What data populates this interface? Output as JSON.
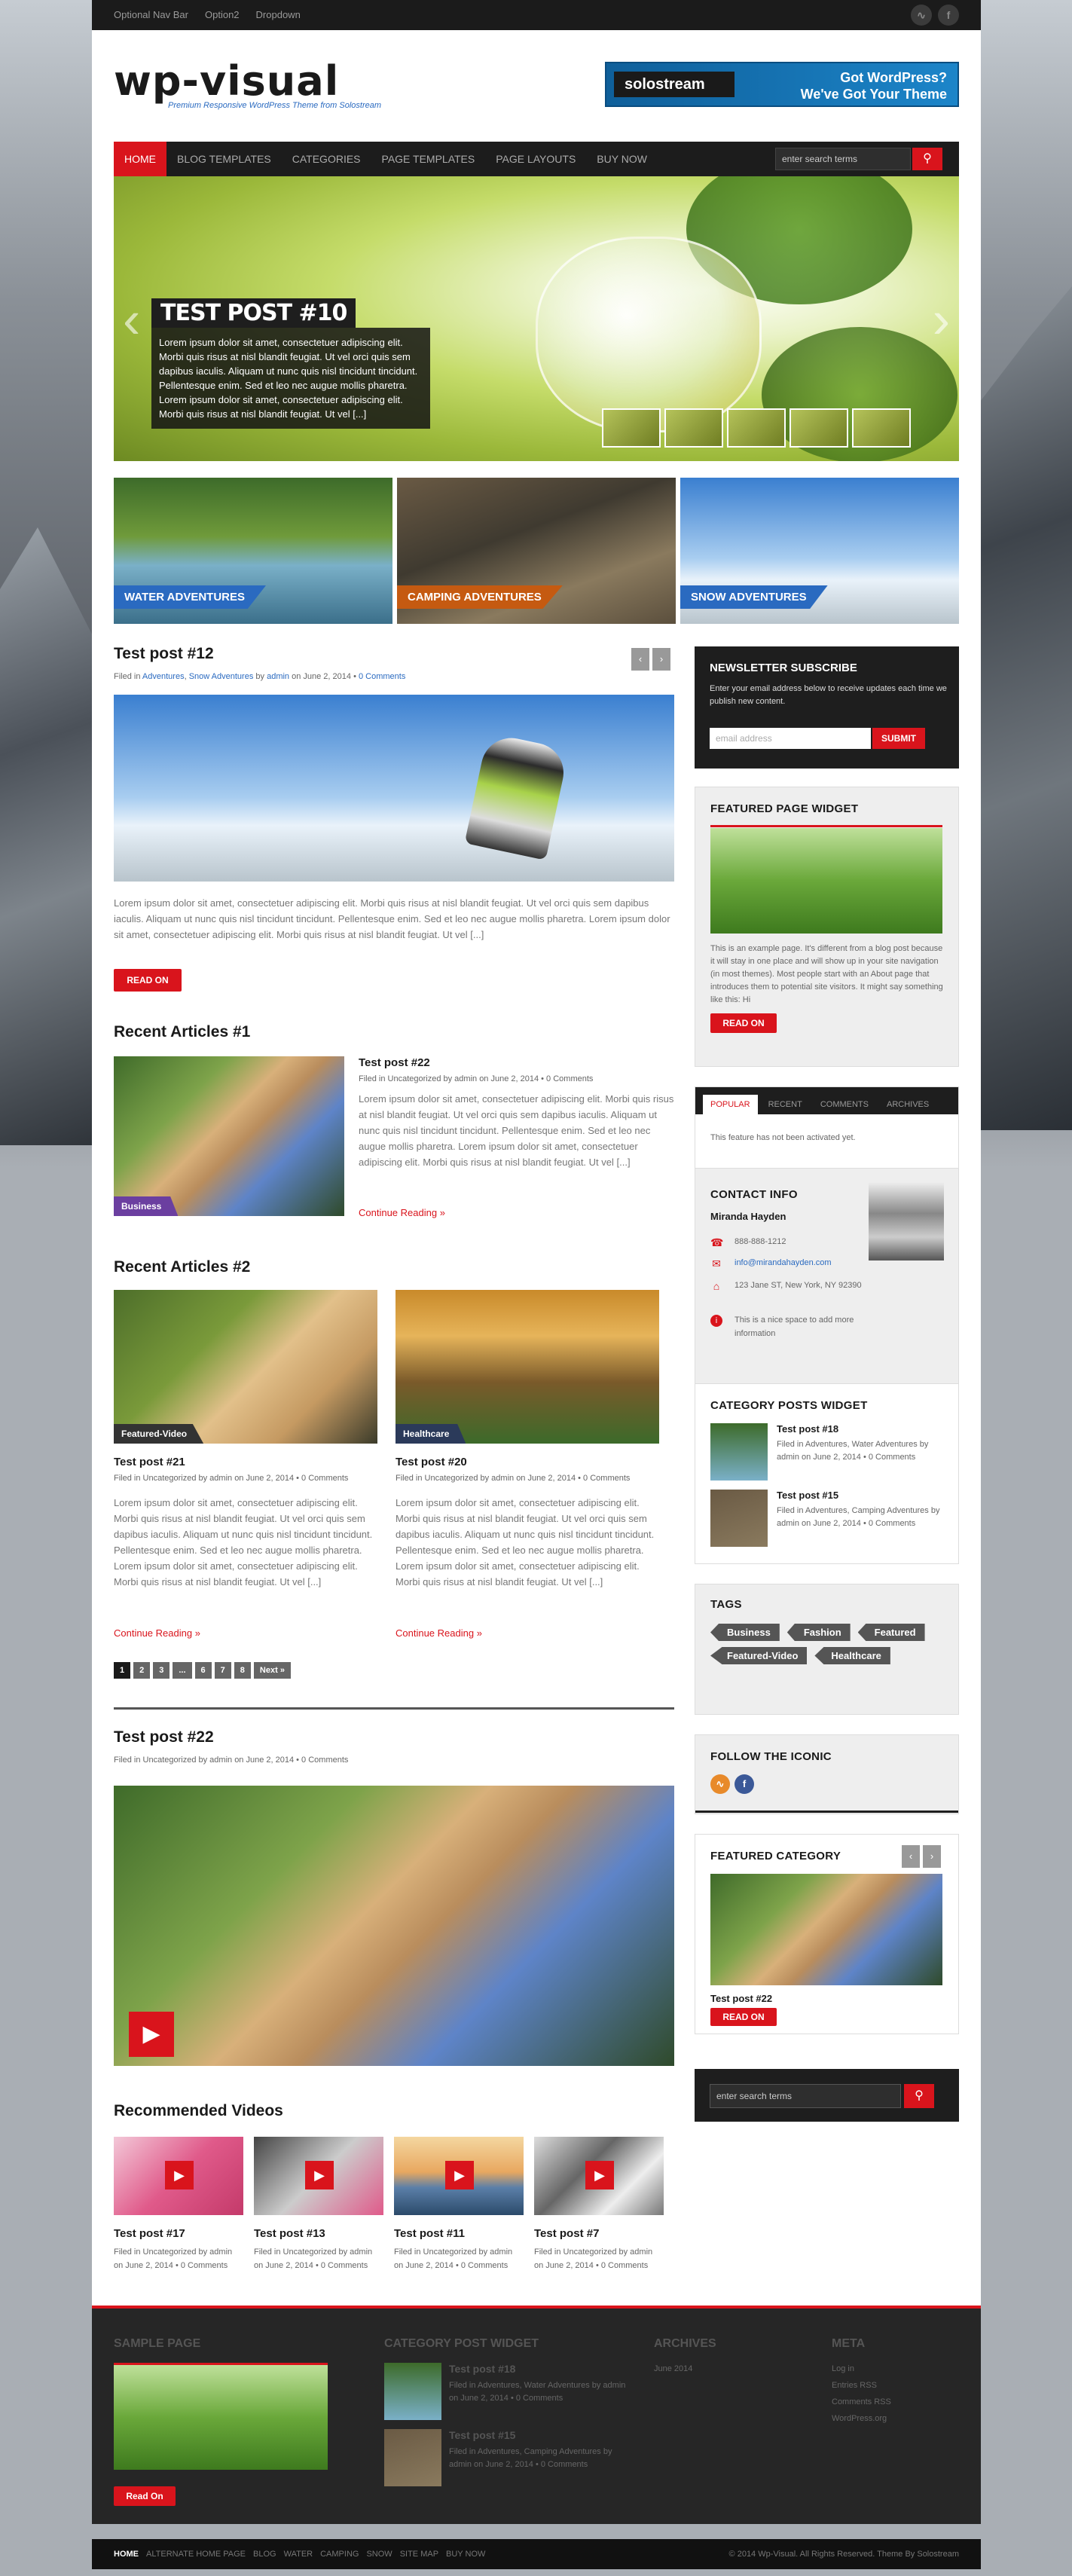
{
  "topbar": {
    "nav": [
      "Optional Nav Bar",
      "Option2",
      "Dropdown"
    ],
    "icons": [
      "rss-icon",
      "facebook-icon"
    ]
  },
  "header": {
    "logo": "wp-visual",
    "tagline": "Premium Responsive WordPress Theme from Solostream",
    "banner": {
      "brand": "solostream",
      "line1": "Got WordPress?",
      "line2": "We've Got Your Theme"
    }
  },
  "nav": {
    "items": [
      "HOME",
      "BLOG TEMPLATES",
      "CATEGORIES",
      "PAGE TEMPLATES",
      "PAGE LAYOUTS",
      "BUY NOW"
    ],
    "search_placeholder": "enter search terms"
  },
  "slider": {
    "title": "TEST POST #10",
    "text": "Lorem ipsum dolor sit amet, consectetuer adipiscing elit. Morbi quis risus at nisl blandit feugiat. Ut vel orci quis sem dapibus iaculis. Aliquam ut nunc quis nisl tincidunt tincidunt. Pellentesque enim. Sed et leo nec augue mollis pharetra. Lorem ipsum dolor sit amet, consectetuer adipiscing elit. Morbi quis risus at nisl blandit feugiat. Ut vel [...]"
  },
  "categories": [
    {
      "label": "WATER ADVENTURES",
      "color": "#2a6ac0"
    },
    {
      "label": "CAMPING ADVENTURES",
      "color": "#c55a11"
    },
    {
      "label": "SNOW ADVENTURES",
      "color": "#2a6ac0"
    }
  ],
  "featured": {
    "title": "Test post #12",
    "meta_pre": "Filed in",
    "cat1": "Adventures",
    "cat2": "Snow Adventures",
    "by": "by",
    "author": "admin",
    "date": "on June 2, 2014 •",
    "comments": "0 Comments",
    "text": "Lorem ipsum dolor sit amet, consectetuer adipiscing elit. Morbi quis risus at nisl blandit feugiat. Ut vel orci quis sem dapibus iaculis. Aliquam ut nunc quis nisl tincidunt tincidunt. Pellentesque enim. Sed et leo nec augue mollis pharetra. Lorem ipsum dolor sit amet, consectetuer adipiscing elit. Morbi quis risus at nisl blandit feugiat. Ut vel [...]",
    "read": "READ ON"
  },
  "recent1": {
    "heading": "Recent Articles #1",
    "title": "Test post #22",
    "meta": "Filed in Uncategorized by admin on June 2, 2014 • 0 Comments",
    "badge": "Business",
    "text": "Lorem ipsum dolor sit amet, consectetuer adipiscing elit. Morbi quis risus at nisl blandit feugiat. Ut vel orci quis sem dapibus iaculis. Aliquam ut nunc quis nisl tincidunt tincidunt. Pellentesque enim. Sed et leo nec augue mollis pharetra. Lorem ipsum dolor sit amet, consectetuer adipiscing elit. Morbi quis risus at nisl blandit feugiat. Ut vel [...]",
    "more": "Continue Reading »"
  },
  "recent2": {
    "heading": "Recent Articles #2",
    "posts": [
      {
        "title": "Test post #21",
        "badge": "Featured-Video",
        "meta": "Filed in Uncategorized by admin on June 2, 2014 • 0 Comments",
        "text": "Lorem ipsum dolor sit amet, consectetuer adipiscing elit. Morbi quis risus at nisl blandit feugiat. Ut vel orci quis sem dapibus iaculis. Aliquam ut nunc quis nisl tincidunt tincidunt. Pellentesque enim. Sed et leo nec augue mollis pharetra. Lorem ipsum dolor sit amet, consectetuer adipiscing elit. Morbi quis risus at nisl blandit feugiat. Ut vel [...]",
        "more": "Continue Reading »"
      },
      {
        "title": "Test post #20",
        "badge": "Healthcare",
        "meta": "Filed in Uncategorized by admin on June 2, 2014 • 0 Comments",
        "text": "Lorem ipsum dolor sit amet, consectetuer adipiscing elit. Morbi quis risus at nisl blandit feugiat. Ut vel orci quis sem dapibus iaculis. Aliquam ut nunc quis nisl tincidunt tincidunt. Pellentesque enim. Sed et leo nec augue mollis pharetra. Lorem ipsum dolor sit amet, consectetuer adipiscing elit. Morbi quis risus at nisl blandit feugiat. Ut vel [...]",
        "more": "Continue Reading »"
      }
    ],
    "pager": [
      "1",
      "2",
      "3",
      "...",
      "6",
      "7",
      "8",
      "Next »"
    ]
  },
  "video_post": {
    "title": "Test post #22",
    "meta": "Filed in Uncategorized by admin on June 2, 2014 • 0 Comments"
  },
  "recommended": {
    "heading": "Recommended Videos",
    "items": [
      {
        "title": "Test post #17",
        "meta": "Filed in Uncategorized by admin on June 2, 2014 • 0 Comments"
      },
      {
        "title": "Test post #13",
        "meta": "Filed in Uncategorized by admin on June 2, 2014 • 0 Comments"
      },
      {
        "title": "Test post #11",
        "meta": "Filed in Uncategorized by admin on June 2, 2014 • 0 Comments"
      },
      {
        "title": "Test post #7",
        "meta": "Filed in Uncategorized by admin on June 2, 2014 • 0 Comments"
      }
    ]
  },
  "sidebar": {
    "newsletter": {
      "heading": "NEWSLETTER SUBSCRIBE",
      "text": "Enter your email address below to receive updates each time we publish new content.",
      "placeholder": "email address",
      "button": "SUBMIT"
    },
    "featured_page": {
      "heading": "FEATURED PAGE WIDGET",
      "text": "This is an example page. It's different from a blog post because it will stay in one place and will show up in your site navigation (in most themes). Most people start with an About page that introduces them to potential site visitors. It might say something like this: Hi",
      "button": "READ ON"
    },
    "tabs": {
      "items": [
        "POPULAR",
        "RECENT",
        "COMMENTS",
        "ARCHIVES"
      ],
      "note": "This feature has not been activated yet."
    },
    "contact": {
      "heading": "CONTACT INFO",
      "name": "Miranda Hayden",
      "phone": "888-888-1212",
      "email": "info@mirandahayden.com",
      "address": "123 Jane ST, New York, NY 92390",
      "note": "This is a nice space to add more information"
    },
    "catposts": {
      "heading": "CATEGORY POSTS WIDGET",
      "items": [
        {
          "title": "Test post #18",
          "meta": "Filed in Adventures, Water Adventures by admin on June 2, 2014 • 0 Comments"
        },
        {
          "title": "Test post #15",
          "meta": "Filed in Adventures, Camping Adventures by admin on June 2, 2014 • 0 Comments"
        }
      ]
    },
    "tags": {
      "heading": "TAGS",
      "items": [
        "Business",
        "Fashion",
        "Featured",
        "Featured-Video",
        "Healthcare"
      ]
    },
    "follow": {
      "heading": "FOLLOW THE ICONIC"
    },
    "featured_cat": {
      "heading": "FEATURED CATEGORY",
      "title": "Test post #22",
      "button": "READ ON"
    },
    "search": {
      "placeholder": "enter search terms"
    }
  },
  "footer": {
    "sample": {
      "heading": "SAMPLE PAGE",
      "button": "Read On"
    },
    "catpost": {
      "heading": "CATEGORY POST WIDGET",
      "items": [
        {
          "title": "Test post #18",
          "meta": "Filed in Adventures, Water Adventures by admin on June 2, 2014 • 0 Comments"
        },
        {
          "title": "Test post #15",
          "meta": "Filed in Adventures, Camping Adventures by admin on June 2, 2014 • 0 Comments"
        }
      ]
    },
    "archives": {
      "heading": "ARCHIVES",
      "items": [
        "June 2014"
      ]
    },
    "meta": {
      "heading": "META",
      "items": [
        "Log in",
        "Entries RSS",
        "Comments RSS",
        "WordPress.org"
      ]
    }
  },
  "bottombar": {
    "links": [
      "HOME",
      "ALTERNATE HOME PAGE",
      "BLOG",
      "WATER",
      "CAMPING",
      "SNOW",
      "SITE MAP",
      "BUY NOW"
    ],
    "copyright": "© 2014 Wp-Visual. All Rights Reserved. Theme By Solostream"
  }
}
